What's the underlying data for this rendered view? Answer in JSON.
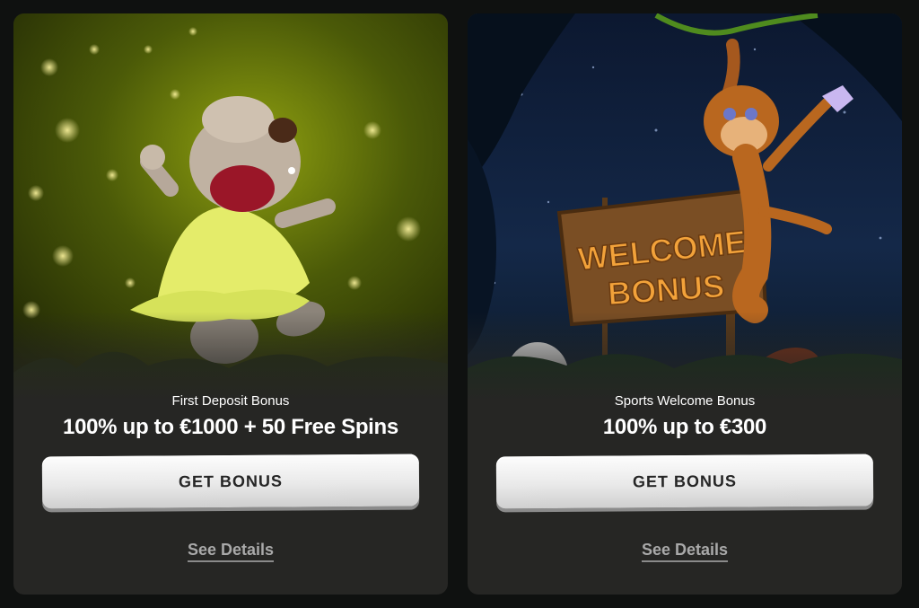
{
  "offers": [
    {
      "subtitle": "First Deposit Bonus",
      "title": "100% up to €1000 + 50 Free Spins",
      "button_label": "GET BONUS",
      "details_label": "See Details"
    },
    {
      "subtitle": "Sports Welcome Bonus",
      "title": "100% up to €300",
      "button_label": "GET BONUS",
      "details_label": "See Details",
      "sign_text": [
        "WELCOME",
        "BONUS"
      ]
    }
  ],
  "colors": {
    "page_background": "#0f1110",
    "card_background": "#262624",
    "button_face": "#ececec",
    "button_text": "#262626",
    "link_text": "#a9a9a9"
  }
}
